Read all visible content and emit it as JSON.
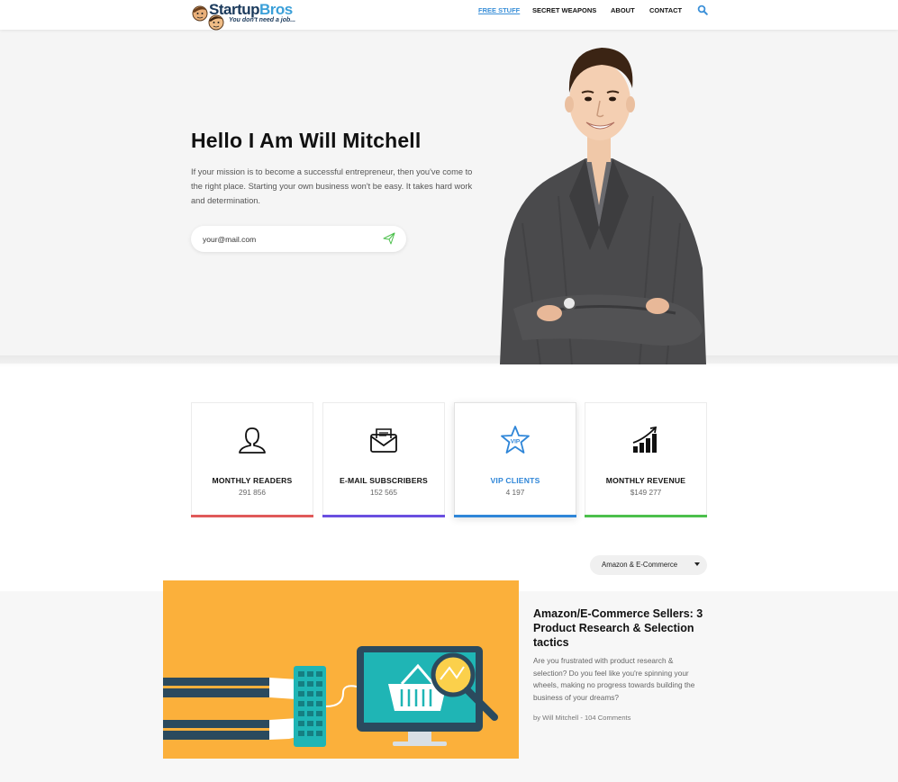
{
  "brand": {
    "name_part1": "Startup",
    "name_part2": "Bros",
    "tagline": "You don't need a job..."
  },
  "nav": {
    "items": [
      {
        "label": "FREE STUFF",
        "active": true
      },
      {
        "label": "SECRET WEAPONS",
        "active": false
      },
      {
        "label": "ABOUT",
        "active": false
      },
      {
        "label": "CONTACT",
        "active": false
      }
    ],
    "search_icon": "search-icon"
  },
  "hero": {
    "title": "Hello I Am Will Mitchell",
    "text": "If your mission is to become a successful entrepreneur, then you've come to the right place. Starting your own business won't be easy. It takes hard work and determination.",
    "email_placeholder": "your@mail.com",
    "send_icon": "paper-plane-icon"
  },
  "stats": [
    {
      "label": "MONTHLY READERS",
      "value": "291 856",
      "icon": "user-icon",
      "color": "#e05a5a"
    },
    {
      "label": "E-MAIL SUBSCRIBERS",
      "value": "152 565",
      "icon": "envelope-icon",
      "color": "#6a4fe0"
    },
    {
      "label": "VIP CLIENTS",
      "value": "4 197",
      "icon": "vip-star-icon",
      "color": "#2f86d8"
    },
    {
      "label": "MONTHLY REVENUE",
      "value": "$149 277",
      "icon": "growth-chart-icon",
      "color": "#4cc04c"
    }
  ],
  "filter": {
    "selected": "Amazon & E-Commerce"
  },
  "article": {
    "title": "Amazon/E-Commerce Sellers: 3 Product Research & Selection tactics",
    "excerpt": "Are you frustrated with product research & selection? Do you feel like you're spinning your wheels, making no progress towards building the business of your dreams?",
    "meta": "by Will Mitchell - 104 Comments"
  },
  "colors": {
    "accent": "#3a8fd8",
    "article_image_bg": "#fbb03b",
    "hero_bg": "#f5f5f5"
  }
}
